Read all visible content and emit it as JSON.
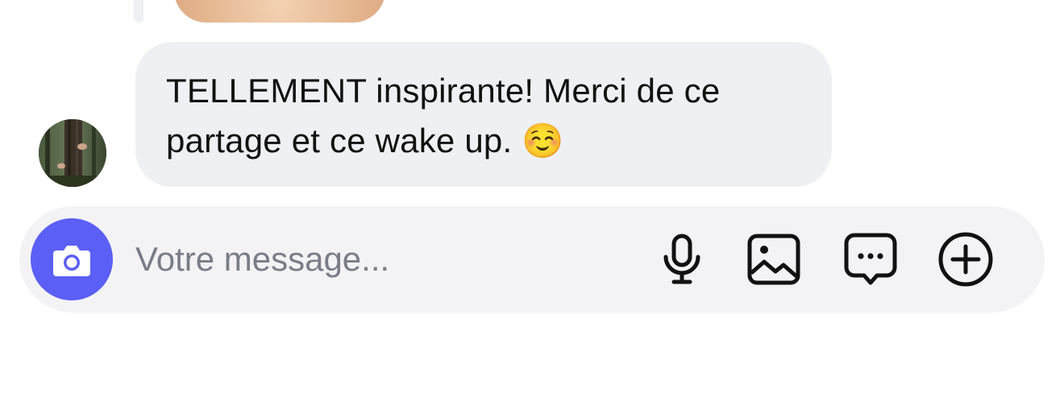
{
  "conversation": {
    "messages": [
      {
        "sender": "other",
        "avatar_icon": "avatar-forest-photo",
        "text": "TELLEMENT inspirante! Merci de ce\npartage et ce wake up. ☺️"
      }
    ]
  },
  "composer": {
    "placeholder": "Votre message...",
    "value": "",
    "buttons": {
      "camera_icon": "camera-icon",
      "mic_icon": "microphone-icon",
      "image_icon": "image-icon",
      "more_icon": "chat-bubble-dots-icon",
      "add_icon": "plus-circle-icon"
    }
  },
  "colors": {
    "accent": "#5b5ff5",
    "bubble_bg": "#eff0f4",
    "composer_bg": "#f3f3f5",
    "placeholder": "#7b7d86",
    "text": "#111111"
  }
}
